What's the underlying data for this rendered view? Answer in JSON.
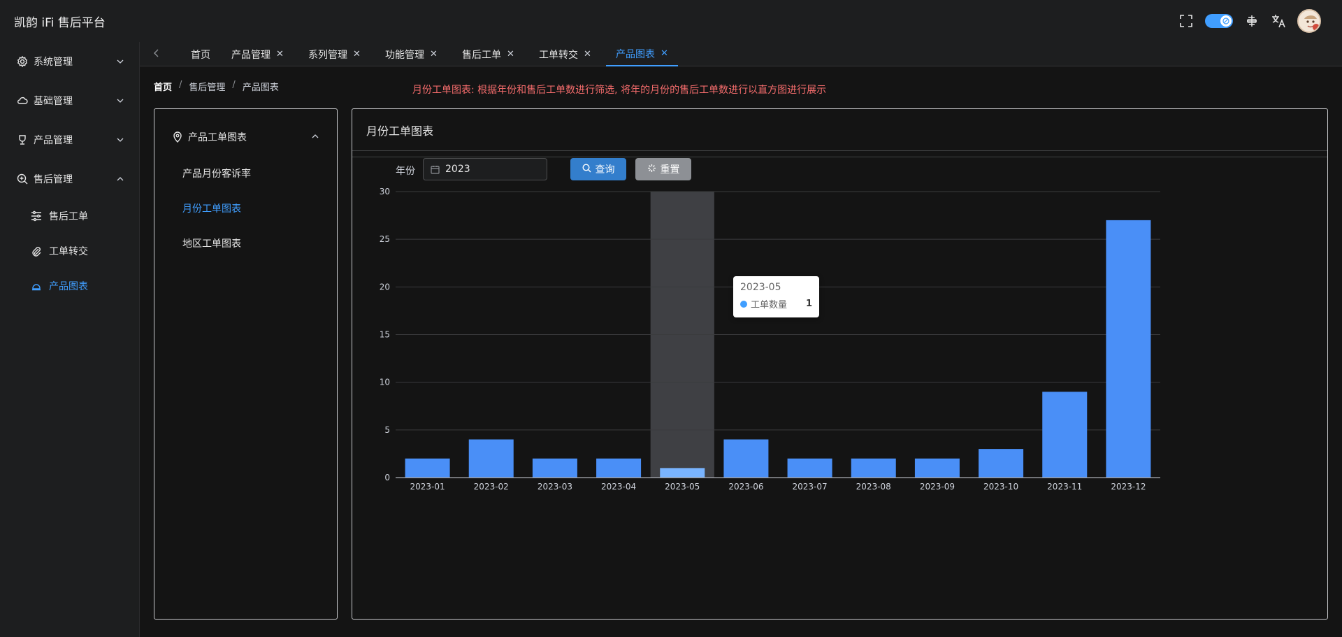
{
  "header": {
    "title": "凯韵 iFi 售后平台",
    "icons": [
      "fullscreen-icon",
      "theme-toggle",
      "layout-icon",
      "translate-icon",
      "avatar"
    ]
  },
  "sidebar": {
    "groups": [
      {
        "label": "系统管理",
        "icon": "gear-icon",
        "expanded": false
      },
      {
        "label": "基础管理",
        "icon": "cloud-icon",
        "expanded": false
      },
      {
        "label": "产品管理",
        "icon": "trophy-icon",
        "expanded": false
      },
      {
        "label": "售后管理",
        "icon": "zoom-in-icon",
        "expanded": true
      }
    ],
    "subitems": [
      {
        "label": "售后工单",
        "icon": "sliders-icon",
        "active": false
      },
      {
        "label": "工单转交",
        "icon": "paperclip-icon",
        "active": false
      },
      {
        "label": "产品图表",
        "icon": "bell-icon",
        "active": true
      }
    ]
  },
  "tabs": [
    {
      "label": "首页",
      "closable": false
    },
    {
      "label": "产品管理",
      "closable": true
    },
    {
      "label": "系列管理",
      "closable": true
    },
    {
      "label": "功能管理",
      "closable": true
    },
    {
      "label": "售后工单",
      "closable": true
    },
    {
      "label": "工单转交",
      "closable": true
    },
    {
      "label": "产品图表",
      "closable": true,
      "active": true
    }
  ],
  "breadcrumb": [
    "首页",
    "售后管理",
    "产品图表"
  ],
  "notice": "月份工单图表: 根据年份和售后工单数进行筛选, 将年的月份的售后工单数进行以直方图进行展示",
  "left_panel": {
    "group_label": "产品工单图表",
    "items": [
      {
        "label": "产品月份客诉率",
        "active": false
      },
      {
        "label": "月份工单图表",
        "active": true
      },
      {
        "label": "地区工单图表",
        "active": false
      }
    ]
  },
  "card": {
    "title": "月份工单图表",
    "year_label": "年份",
    "year_value": "2023",
    "query_label": "查询",
    "reset_label": "重置"
  },
  "tooltip": {
    "title": "2023-05",
    "series": "工单数量",
    "value": "1"
  },
  "colors": {
    "accent": "#409eff",
    "notice": "#f56c6c",
    "bar": "#4a8ff7",
    "bar_highlight": "#79b4ff"
  },
  "chart_data": {
    "type": "bar",
    "categories": [
      "2023-01",
      "2023-02",
      "2023-03",
      "2023-04",
      "2023-05",
      "2023-06",
      "2023-07",
      "2023-08",
      "2023-09",
      "2023-10",
      "2023-11",
      "2023-12"
    ],
    "series": [
      {
        "name": "工单数量",
        "values": [
          2,
          4,
          2,
          2,
          1,
          4,
          2,
          2,
          2,
          3,
          9,
          27
        ]
      }
    ],
    "ylim": [
      0,
      30
    ],
    "yticks": [
      0,
      5,
      10,
      15,
      20,
      25,
      30
    ],
    "grid": true,
    "highlight_category": "2023-05"
  }
}
